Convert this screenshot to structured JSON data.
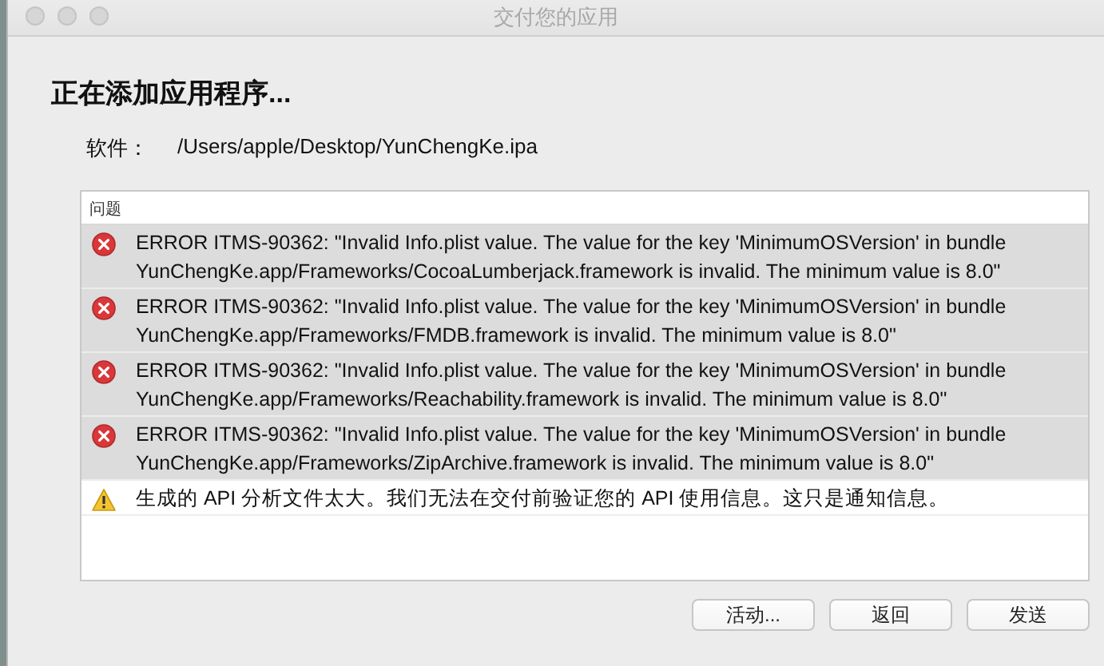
{
  "window": {
    "title": "交付您的应用"
  },
  "heading": "正在添加应用程序...",
  "software": {
    "label": "软件：",
    "path": "/Users/apple/Desktop/YunChengKe.ipa"
  },
  "issues": {
    "header": "问题",
    "rows": [
      {
        "kind": "error",
        "message": "ERROR ITMS-90362: \"Invalid Info.plist value. The value for the key 'MinimumOSVersion' in bundle YunChengKe.app/Frameworks/CocoaLumberjack.framework is invalid. The minimum value is 8.0\""
      },
      {
        "kind": "error",
        "message": "ERROR ITMS-90362: \"Invalid Info.plist value. The value for the key 'MinimumOSVersion' in bundle YunChengKe.app/Frameworks/FMDB.framework is invalid. The minimum value is 8.0\""
      },
      {
        "kind": "error",
        "message": "ERROR ITMS-90362: \"Invalid Info.plist value. The value for the key 'MinimumOSVersion' in bundle YunChengKe.app/Frameworks/Reachability.framework is invalid. The minimum value is 8.0\""
      },
      {
        "kind": "error",
        "message": "ERROR ITMS-90362: \"Invalid Info.plist value. The value for the key 'MinimumOSVersion' in bundle YunChengKe.app/Frameworks/ZipArchive.framework is invalid. The minimum value is 8.0\""
      },
      {
        "kind": "warning",
        "message": "生成的 API 分析文件太大。我们无法在交付前验证您的 API 使用信息。这只是通知信息。"
      }
    ]
  },
  "buttons": [
    "活动...",
    "返回",
    "发送"
  ]
}
